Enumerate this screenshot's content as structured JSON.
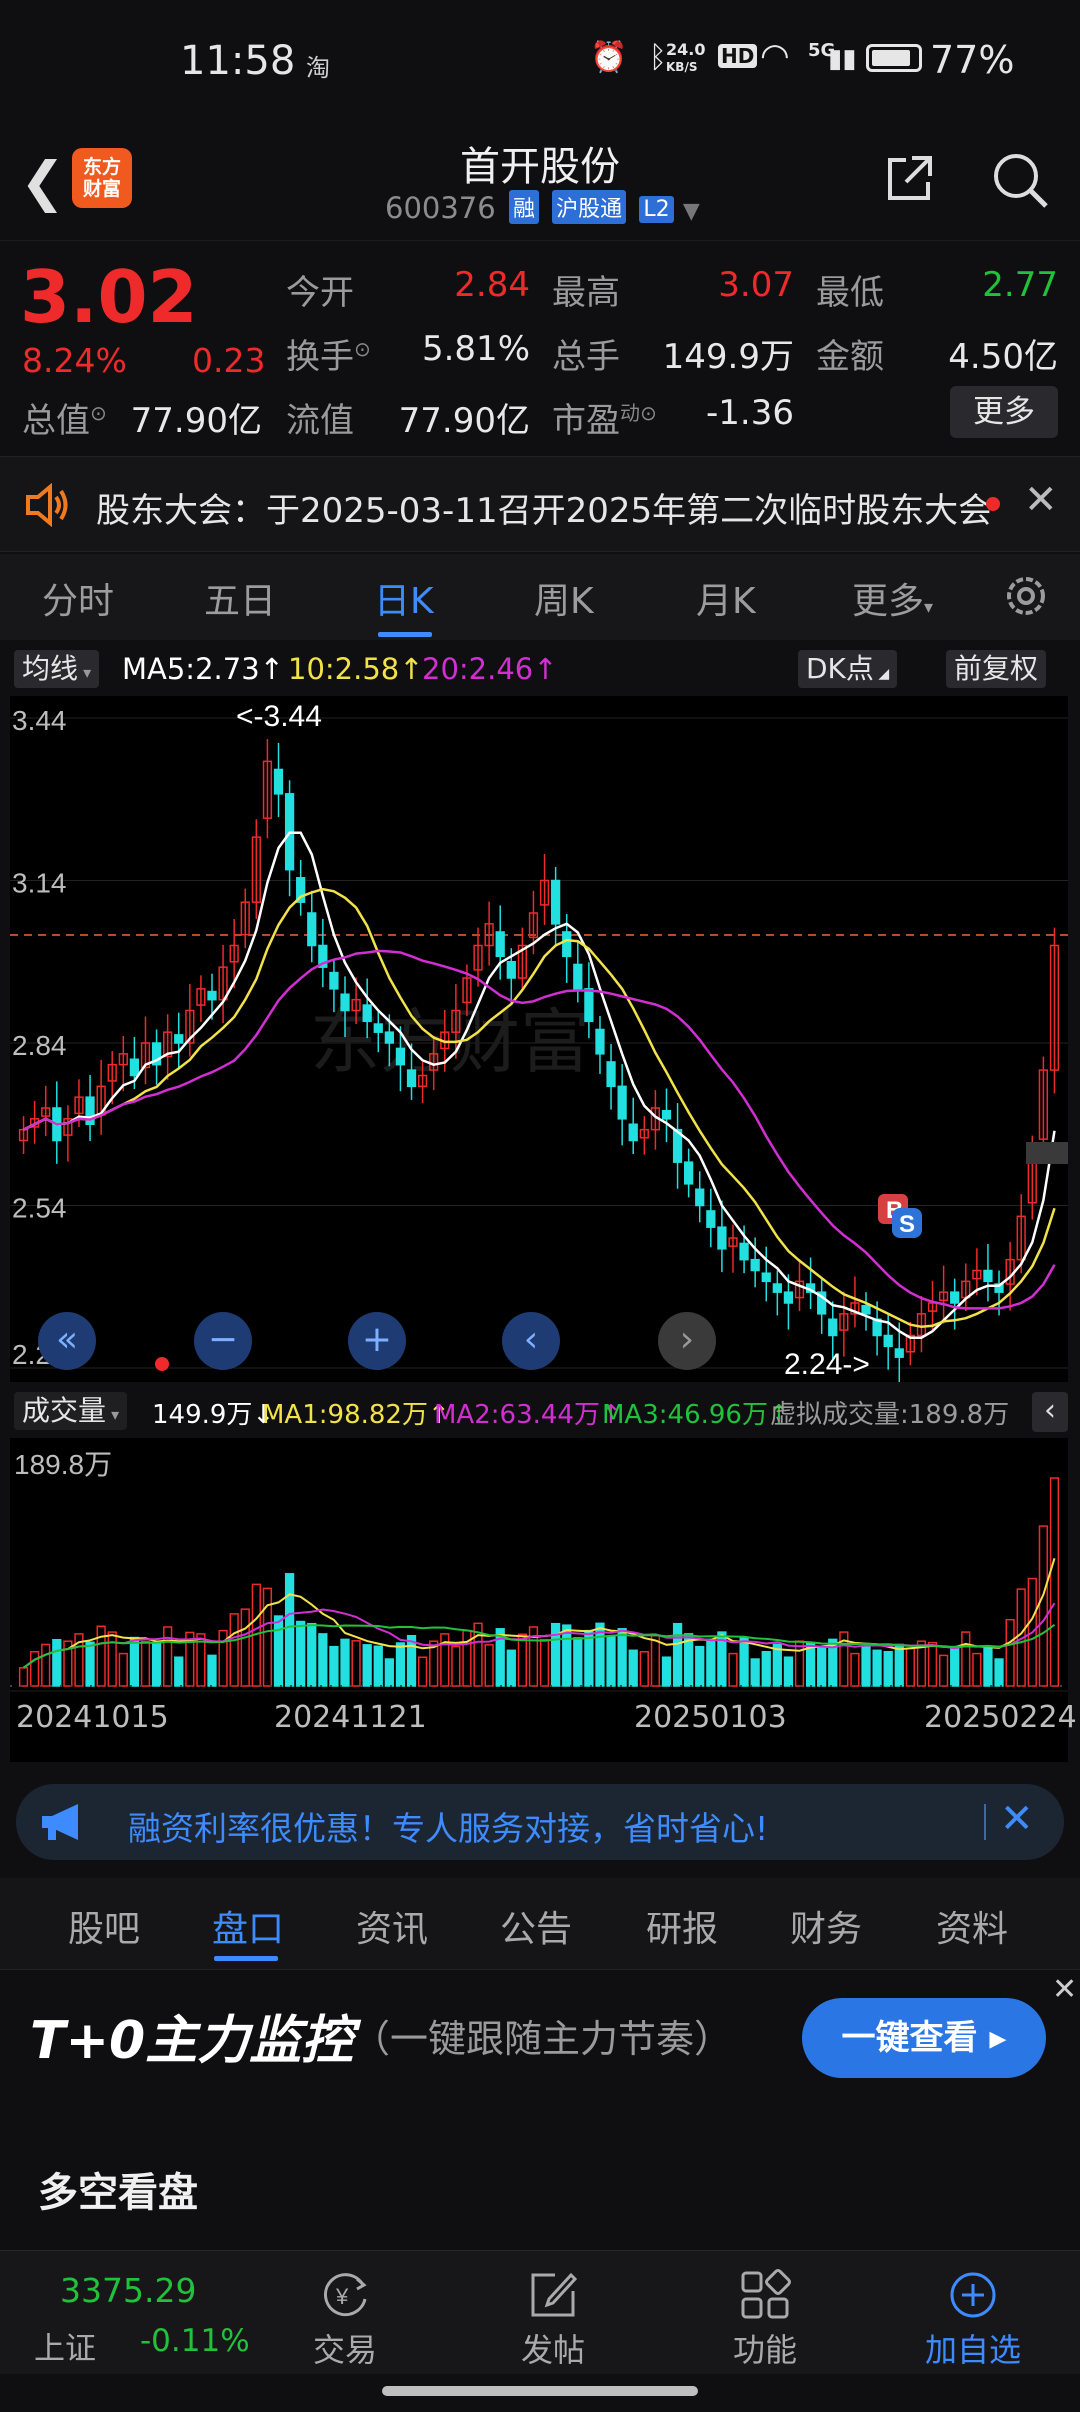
{
  "status": {
    "time": "11:58",
    "app_hint": "淘",
    "net_speed_top": "24.0",
    "net_speed_unit": "KB/S",
    "hd": "HD",
    "signal": "5G",
    "battery": "77%"
  },
  "header": {
    "logo_line1": "东方",
    "logo_line2": "财富",
    "title": "首开股份",
    "code": "600376",
    "tags": [
      "融",
      "沪股通",
      "L2"
    ]
  },
  "quote": {
    "price": "3.02",
    "change_pct": "8.24%",
    "change": "0.23",
    "open_label": "今开",
    "open": "2.84",
    "high_label": "最高",
    "high": "3.07",
    "low_label": "最低",
    "low": "2.77",
    "turnover_label": "换手",
    "turnover": "5.81%",
    "volume_label": "总手",
    "volume": "149.9万",
    "amount_label": "金额",
    "amount": "4.50亿",
    "mktcap_label": "总值",
    "mktcap": "77.90亿",
    "float_label": "流值",
    "float": "77.90亿",
    "pe_label": "市盈",
    "pe_sup": "动",
    "pe": "-1.36",
    "more": "更多"
  },
  "notice": {
    "text": "股东大会：于2025-03-11召开2025年第二次临时股东大会"
  },
  "period_tabs": [
    "分时",
    "五日",
    "日K",
    "周K",
    "月K",
    "更多"
  ],
  "indicator_bar": {
    "ma_type": "均线",
    "ma5": "MA5:2.73",
    "ma10": "10:2.58",
    "ma20": "20:2.46",
    "dk": "DK点",
    "adjust": "前复权"
  },
  "chart_data": [
    {
      "type": "candlestick",
      "y_ticks": [
        "3.44",
        "3.14",
        "2.84",
        "2.54",
        "2.24"
      ],
      "ylim": [
        2.24,
        3.44
      ],
      "max_label": "<-3.44",
      "min_label": "2.24->",
      "signals": [
        "B",
        "S"
      ],
      "series": [
        {
          "name": "MA5",
          "color": "#ffffff",
          "last": 2.73
        },
        {
          "name": "MA10",
          "color": "#f2e24a",
          "last": 2.58
        },
        {
          "name": "MA20",
          "color": "#d12fd1",
          "last": 2.46
        }
      ],
      "close": [
        2.68,
        2.7,
        2.72,
        2.66,
        2.7,
        2.74,
        2.69,
        2.76,
        2.8,
        2.82,
        2.78,
        2.84,
        2.8,
        2.86,
        2.84,
        2.9,
        2.94,
        2.92,
        2.98,
        3.02,
        3.1,
        3.22,
        3.36,
        3.3,
        3.16,
        3.1,
        3.02,
        2.98,
        2.94,
        2.9,
        2.92,
        2.88,
        2.86,
        2.84,
        2.8,
        2.76,
        2.78,
        2.82,
        2.86,
        2.9,
        2.96,
        3.02,
        3.06,
        3.0,
        2.96,
        3.02,
        3.08,
        3.14,
        3.06,
        3.0,
        2.94,
        2.88,
        2.82,
        2.76,
        2.7,
        2.66,
        2.68,
        2.72,
        2.7,
        2.62,
        2.58,
        2.54,
        2.5,
        2.46,
        2.48,
        2.44,
        2.42,
        2.4,
        2.38,
        2.36,
        2.4,
        2.38,
        2.34,
        2.3,
        2.34,
        2.36,
        2.34,
        2.3,
        2.28,
        2.26,
        2.3,
        2.34,
        2.36,
        2.38,
        2.36,
        2.4,
        2.42,
        2.4,
        2.38,
        2.44,
        2.52,
        2.62,
        2.79,
        3.02
      ]
    },
    {
      "type": "bar",
      "title": "成交量",
      "volume": "149.9万",
      "ma1": "MA1:98.82万",
      "ma2": "MA2:63.44万",
      "ma3": "MA3:46.96万",
      "virtual": "虚拟成交量:189.8万",
      "y_max_label": "189.8万",
      "dates": [
        "20241015",
        "20241121",
        "20250103",
        "20250224"
      ]
    }
  ],
  "ad": {
    "text": "融资利率很优惠！专人服务对接，省时省心!"
  },
  "info_tabs": [
    "股吧",
    "盘口",
    "资讯",
    "公告",
    "研报",
    "财务",
    "资料"
  ],
  "promo": {
    "headline": "T+0主力监控",
    "sub": "（一键跟随主力节奏）",
    "button": "一键查看 ▸"
  },
  "section_title": "多空看盘",
  "bottom_nav": {
    "index_value": "3375.29",
    "index_name": "上证",
    "index_change": "-0.11%",
    "items": [
      "交易",
      "发帖",
      "功能",
      "加自选"
    ]
  }
}
